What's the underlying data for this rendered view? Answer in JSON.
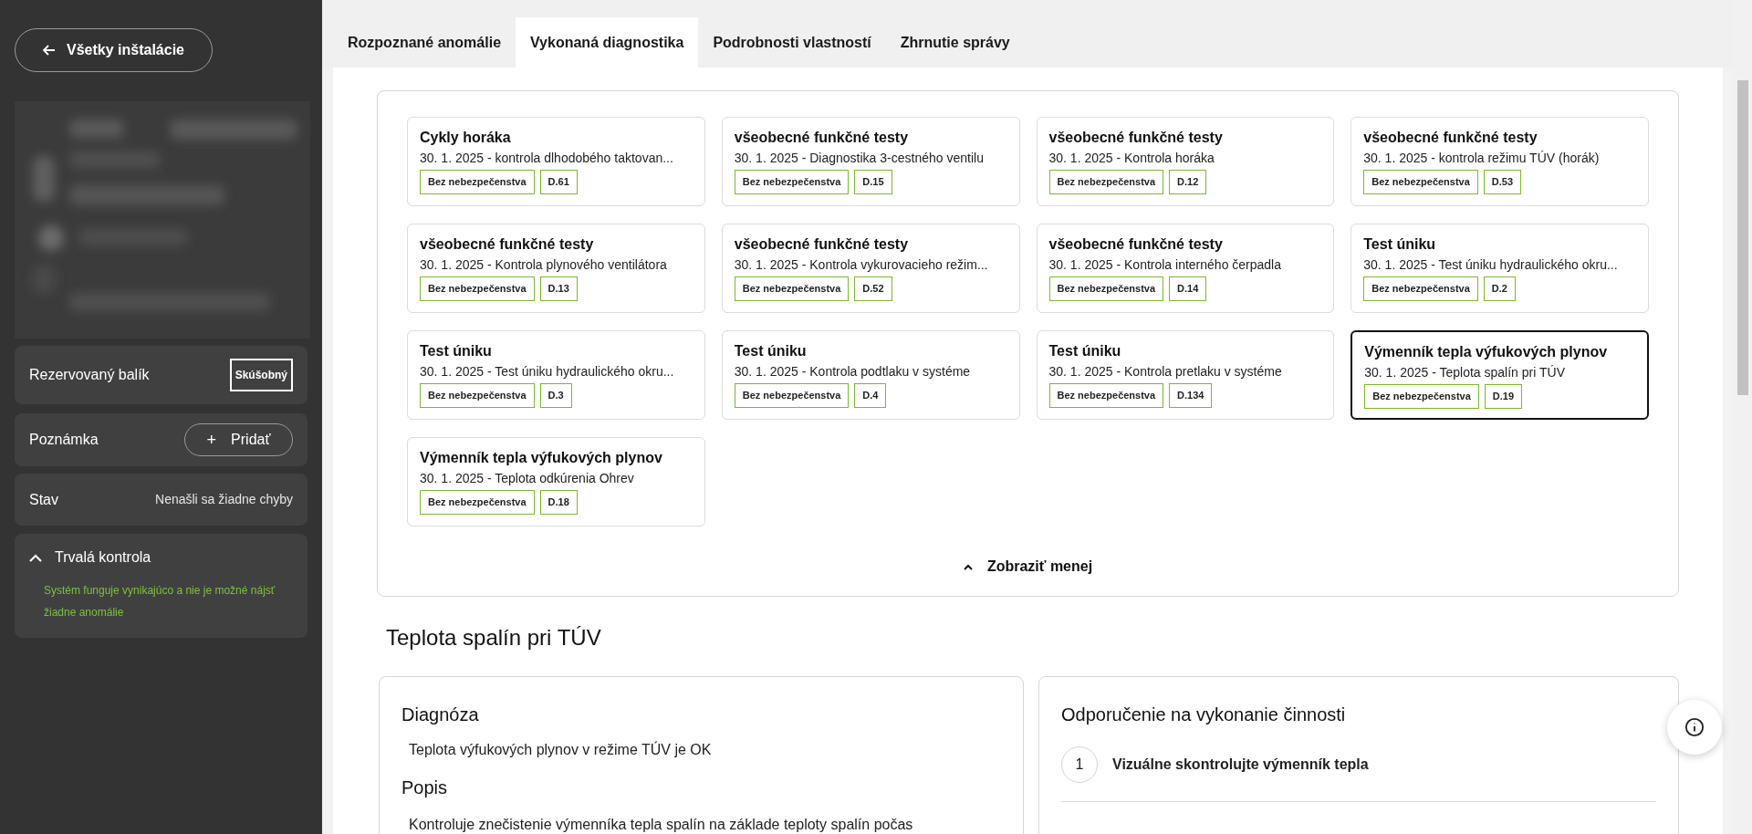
{
  "sidebar": {
    "back_button": "Všetky inštalácie",
    "package": {
      "label": "Rezervovaný balík",
      "badge": "Skúšobný"
    },
    "note": {
      "label": "Poznámka",
      "button_icon": "+",
      "button": "Pridať"
    },
    "status": {
      "label": "Stav",
      "value": "Nenašli sa žiadne chyby"
    },
    "monitoring": {
      "title": "Trvalá kontrola",
      "expanded": true,
      "message": "Systém funguje vynikajúco a nie je možné nájsť žiadne anomálie"
    }
  },
  "tabs": [
    {
      "label": "Rozpoznané anomálie",
      "selected": false
    },
    {
      "label": "Vykonaná diagnostika",
      "selected": true
    },
    {
      "label": "Podrobnosti vlastností",
      "selected": false
    },
    {
      "label": "Zhrnutie správy",
      "selected": false
    }
  ],
  "diagnostics": [
    {
      "title": "Cykly horáka",
      "subtitle": "30. 1. 2025 - kontrola dlhodobého taktovan...",
      "severity": "Bez nebezpečenstva",
      "code": "D.61",
      "selected": false
    },
    {
      "title": "všeobecné funkčné testy",
      "subtitle": "30. 1. 2025 - Diagnostika 3-cestného ventilu",
      "severity": "Bez nebezpečenstva",
      "code": "D.15",
      "selected": false
    },
    {
      "title": "všeobecné funkčné testy",
      "subtitle": "30. 1. 2025 - Kontrola horáka",
      "severity": "Bez nebezpečenstva",
      "code": "D.12",
      "selected": false
    },
    {
      "title": "všeobecné funkčné testy",
      "subtitle": "30. 1. 2025 - kontrola režimu TÚV (horák)",
      "severity": "Bez nebezpečenstva",
      "code": "D.53",
      "selected": false
    },
    {
      "title": "všeobecné funkčné testy",
      "subtitle": "30. 1. 2025 - Kontrola plynového ventilátora",
      "severity": "Bez nebezpečenstva",
      "code": "D.13",
      "selected": false
    },
    {
      "title": "všeobecné funkčné testy",
      "subtitle": "30. 1. 2025 - Kontrola vykurovacieho režim...",
      "severity": "Bez nebezpečenstva",
      "code": "D.52",
      "selected": false
    },
    {
      "title": "všeobecné funkčné testy",
      "subtitle": "30. 1. 2025 - Kontrola interného čerpadla",
      "severity": "Bez nebezpečenstva",
      "code": "D.14",
      "selected": false
    },
    {
      "title": "Test úniku",
      "subtitle": "30. 1. 2025 - Test úniku hydraulického okru...",
      "severity": "Bez nebezpečenstva",
      "code": "D.2",
      "selected": false
    },
    {
      "title": "Test úniku",
      "subtitle": "30. 1. 2025 - Test úniku hydraulického okru...",
      "severity": "Bez nebezpečenstva",
      "code": "D.3",
      "selected": false
    },
    {
      "title": "Test úniku",
      "subtitle": "30. 1. 2025 - Kontrola podtlaku v systéme",
      "severity": "Bez nebezpečenstva",
      "code": "D.4",
      "selected": false
    },
    {
      "title": "Test úniku",
      "subtitle": "30. 1. 2025 - Kontrola pretlaku v systéme",
      "severity": "Bez nebezpečenstva",
      "code": "D.134",
      "selected": false
    },
    {
      "title": "Výmenník tepla výfukových plynov",
      "subtitle": "30. 1. 2025 - Teplota spalín pri TÚV",
      "severity": "Bez nebezpečenstva",
      "code": "D.19",
      "selected": true
    },
    {
      "title": "Výmenník tepla výfukových plynov",
      "subtitle": "30. 1. 2025 - Teplota odkúrenia Ohrev",
      "severity": "Bez nebezpečenstva",
      "code": "D.18",
      "selected": false
    }
  ],
  "show_less": "Zobraziť menej",
  "detail": {
    "title": "Teplota spalín pri TÚV",
    "diagnosis_heading": "Diagnóza",
    "diagnosis": "Teplota výfukových plynov v režime TÚV je OK",
    "description_heading": "Popis",
    "description": "Kontroluje znečistenie výmenníka tepla spalín na základe teploty spalín počas",
    "recommendation_heading": "Odporučenie na vykonanie činnosti",
    "steps": [
      {
        "number": "1",
        "text": "Vizuálne skontrolujte výmenník tepla"
      }
    ]
  }
}
